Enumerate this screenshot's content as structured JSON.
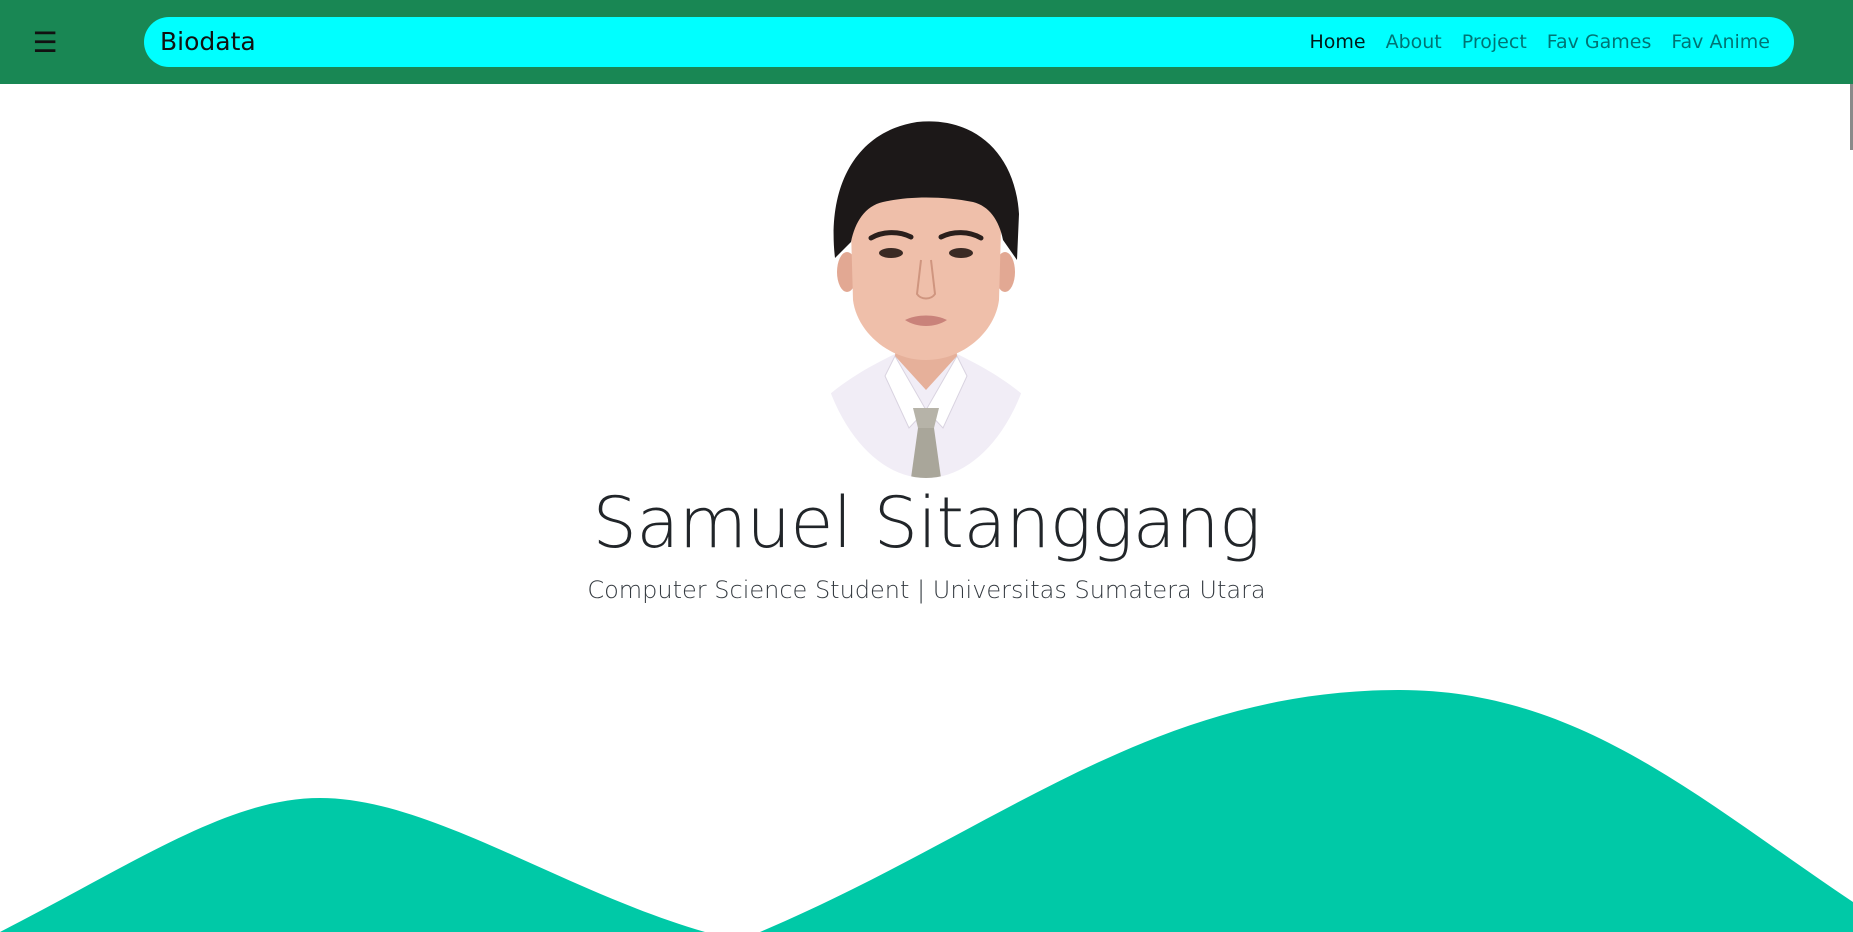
{
  "header": {
    "menu_icon_glyph": "☰",
    "brand": "Biodata",
    "nav": [
      {
        "label": "Home",
        "active": true
      },
      {
        "label": "About",
        "active": false
      },
      {
        "label": "Project",
        "active": false
      },
      {
        "label": "Fav Games",
        "active": false
      },
      {
        "label": "Fav Anime",
        "active": false
      }
    ]
  },
  "profile": {
    "name": "Samuel Sitanggang",
    "subtitle": "Computer Science Student | Universitas Sumatera Utara"
  },
  "colors": {
    "header_bar": "#198754",
    "navbar": "#00ffff",
    "wave": "#00c9a7"
  },
  "icons": {
    "menu": "hamburger-menu-icon"
  }
}
